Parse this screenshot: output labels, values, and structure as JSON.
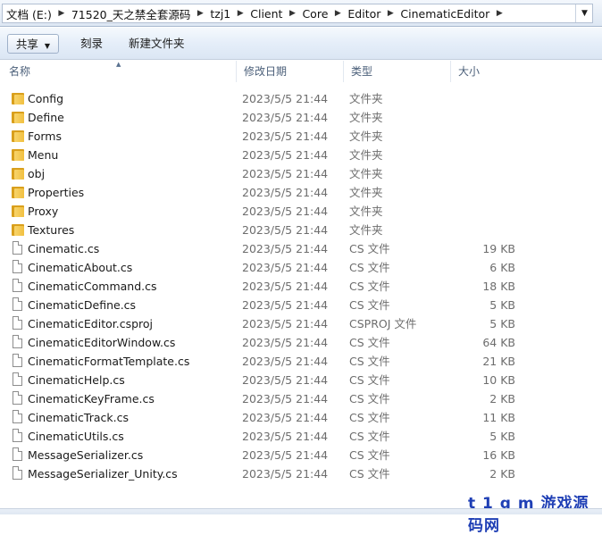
{
  "breadcrumb": [
    "文档 (E:)",
    "71520_天之禁全套源码",
    "tzj1",
    "Client",
    "Core",
    "Editor",
    "CinematicEditor"
  ],
  "toolbar": {
    "share": "共享",
    "burn": "刻录",
    "new_folder": "新建文件夹"
  },
  "columns": {
    "name": "名称",
    "date": "修改日期",
    "type": "类型",
    "size": "大小"
  },
  "files": [
    {
      "name": "Config",
      "date": "2023/5/5 21:44",
      "type": "文件夹",
      "size": "",
      "kind": "folder"
    },
    {
      "name": "Define",
      "date": "2023/5/5 21:44",
      "type": "文件夹",
      "size": "",
      "kind": "folder"
    },
    {
      "name": "Forms",
      "date": "2023/5/5 21:44",
      "type": "文件夹",
      "size": "",
      "kind": "folder"
    },
    {
      "name": "Menu",
      "date": "2023/5/5 21:44",
      "type": "文件夹",
      "size": "",
      "kind": "folder"
    },
    {
      "name": "obj",
      "date": "2023/5/5 21:44",
      "type": "文件夹",
      "size": "",
      "kind": "folder"
    },
    {
      "name": "Properties",
      "date": "2023/5/5 21:44",
      "type": "文件夹",
      "size": "",
      "kind": "folder"
    },
    {
      "name": "Proxy",
      "date": "2023/5/5 21:44",
      "type": "文件夹",
      "size": "",
      "kind": "folder"
    },
    {
      "name": "Textures",
      "date": "2023/5/5 21:44",
      "type": "文件夹",
      "size": "",
      "kind": "folder"
    },
    {
      "name": "Cinematic.cs",
      "date": "2023/5/5 21:44",
      "type": "CS 文件",
      "size": "19 KB",
      "kind": "file"
    },
    {
      "name": "CinematicAbout.cs",
      "date": "2023/5/5 21:44",
      "type": "CS 文件",
      "size": "6 KB",
      "kind": "file"
    },
    {
      "name": "CinematicCommand.cs",
      "date": "2023/5/5 21:44",
      "type": "CS 文件",
      "size": "18 KB",
      "kind": "file"
    },
    {
      "name": "CinematicDefine.cs",
      "date": "2023/5/5 21:44",
      "type": "CS 文件",
      "size": "5 KB",
      "kind": "file"
    },
    {
      "name": "CinematicEditor.csproj",
      "date": "2023/5/5 21:44",
      "type": "CSPROJ 文件",
      "size": "5 KB",
      "kind": "file"
    },
    {
      "name": "CinematicEditorWindow.cs",
      "date": "2023/5/5 21:44",
      "type": "CS 文件",
      "size": "64 KB",
      "kind": "file"
    },
    {
      "name": "CinematicFormatTemplate.cs",
      "date": "2023/5/5 21:44",
      "type": "CS 文件",
      "size": "21 KB",
      "kind": "file"
    },
    {
      "name": "CinematicHelp.cs",
      "date": "2023/5/5 21:44",
      "type": "CS 文件",
      "size": "10 KB",
      "kind": "file"
    },
    {
      "name": "CinematicKeyFrame.cs",
      "date": "2023/5/5 21:44",
      "type": "CS 文件",
      "size": "2 KB",
      "kind": "file"
    },
    {
      "name": "CinematicTrack.cs",
      "date": "2023/5/5 21:44",
      "type": "CS 文件",
      "size": "11 KB",
      "kind": "file"
    },
    {
      "name": "CinematicUtils.cs",
      "date": "2023/5/5 21:44",
      "type": "CS 文件",
      "size": "5 KB",
      "kind": "file"
    },
    {
      "name": "MessageSerializer.cs",
      "date": "2023/5/5 21:44",
      "type": "CS 文件",
      "size": "16 KB",
      "kind": "file"
    },
    {
      "name": "MessageSerializer_Unity.cs",
      "date": "2023/5/5 21:44",
      "type": "CS 文件",
      "size": "2 KB",
      "kind": "file"
    }
  ],
  "watermark": "t 1 g m 游戏源码网"
}
